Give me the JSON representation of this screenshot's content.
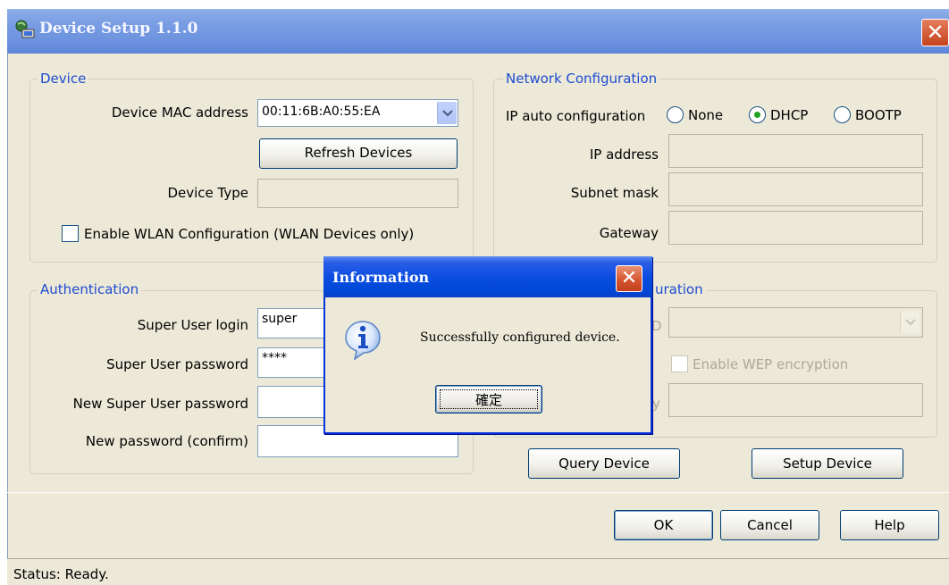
{
  "window": {
    "title": "Device Setup 1.1.0",
    "close_glyph": "✕"
  },
  "device_group": {
    "label": "Device",
    "mac_label": "Device MAC address",
    "mac_value": "00:11:6B:A0:55:EA",
    "refresh_label": "Refresh Devices",
    "type_label": "Device Type",
    "type_value": "",
    "wlan_label": "Enable WLAN Configuration (WLAN Devices only)",
    "wlan_checked": false
  },
  "network_group": {
    "label": "Network Configuration",
    "ip_auto_label": "IP auto configuration",
    "options": [
      "None",
      "DHCP",
      "BOOTP"
    ],
    "selected": "DHCP",
    "ip_label": "IP address",
    "subnet_label": "Subnet mask",
    "gateway_label": "Gateway"
  },
  "auth_group": {
    "label": "Authentication",
    "login_label": "Super User login",
    "login_value": "super",
    "password_label": "Super User password",
    "password_value": "****",
    "new_password_label": "New Super User password",
    "new_password_value": "",
    "confirm_label": "New password (confirm)",
    "confirm_value": ""
  },
  "wlan_group": {
    "label_visible": "uration",
    "wep_label": "Enable WEP encryption",
    "partial_label_1": "D",
    "partial_label_2": "y"
  },
  "buttons": {
    "query": "Query Device",
    "setup": "Setup Device",
    "ok": "OK",
    "cancel": "Cancel",
    "help": "Help"
  },
  "status": {
    "text": "Status: Ready."
  },
  "dialog": {
    "title": "Information",
    "message": "Successfully configured device.",
    "ok_label": "確定",
    "icon": "information-icon"
  },
  "colors": {
    "titlebar": "#7a9ee4",
    "dialog_titlebar": "#0b4ee0",
    "group_label": "#1e4bd1",
    "face": "#ece9d8"
  }
}
